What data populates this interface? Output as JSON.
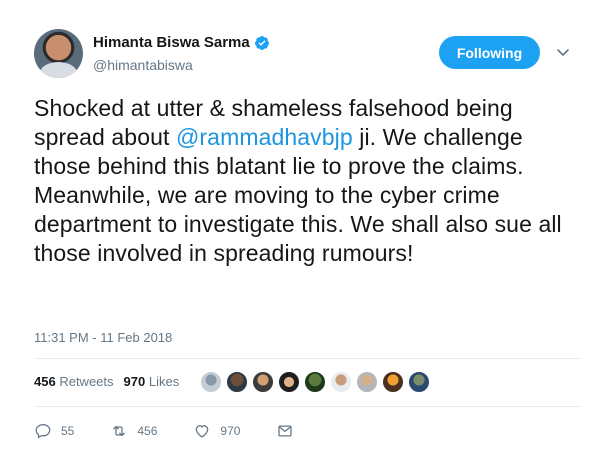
{
  "author": {
    "name": "Himanta Biswa Sarma",
    "handle": "@himantabiswa"
  },
  "follow_button": {
    "label": "Following"
  },
  "tweet": {
    "text_before": "Shocked at utter & shameless falsehood being spread about ",
    "mention": "@rammadhavbjp",
    "text_after": " ji. We challenge those behind this blatant lie to prove the claims. Meanwhile, we are moving to the cyber crime department to investigate this. We shall also sue all those involved in spreading rumours!",
    "timestamp": "11:31 PM - 11 Feb 2018"
  },
  "stats": {
    "retweets_count": "456",
    "retweets_label": "Retweets",
    "likes_count": "970",
    "likes_label": "Likes"
  },
  "actions": {
    "replies": "55",
    "retweets": "456",
    "likes": "970"
  },
  "icons": [
    "verified-icon",
    "chevron-down-icon",
    "reply-icon",
    "retweet-icon",
    "like-icon",
    "message-icon"
  ],
  "colors": {
    "accent": "#1da1f2",
    "mention": "#1b95e0",
    "muted": "#657786"
  }
}
